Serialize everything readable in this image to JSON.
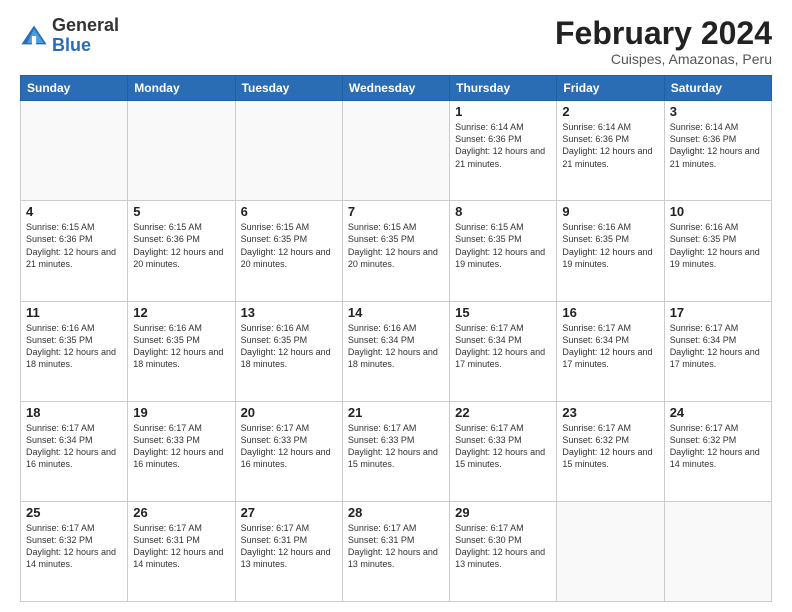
{
  "logo": {
    "general": "General",
    "blue": "Blue"
  },
  "header": {
    "title": "February 2024",
    "location": "Cuispes, Amazonas, Peru"
  },
  "weekdays": [
    "Sunday",
    "Monday",
    "Tuesday",
    "Wednesday",
    "Thursday",
    "Friday",
    "Saturday"
  ],
  "weeks": [
    [
      {
        "day": "",
        "info": ""
      },
      {
        "day": "",
        "info": ""
      },
      {
        "day": "",
        "info": ""
      },
      {
        "day": "",
        "info": ""
      },
      {
        "day": "1",
        "info": "Sunrise: 6:14 AM\nSunset: 6:36 PM\nDaylight: 12 hours and 21 minutes."
      },
      {
        "day": "2",
        "info": "Sunrise: 6:14 AM\nSunset: 6:36 PM\nDaylight: 12 hours and 21 minutes."
      },
      {
        "day": "3",
        "info": "Sunrise: 6:14 AM\nSunset: 6:36 PM\nDaylight: 12 hours and 21 minutes."
      }
    ],
    [
      {
        "day": "4",
        "info": "Sunrise: 6:15 AM\nSunset: 6:36 PM\nDaylight: 12 hours and 21 minutes."
      },
      {
        "day": "5",
        "info": "Sunrise: 6:15 AM\nSunset: 6:36 PM\nDaylight: 12 hours and 20 minutes."
      },
      {
        "day": "6",
        "info": "Sunrise: 6:15 AM\nSunset: 6:35 PM\nDaylight: 12 hours and 20 minutes."
      },
      {
        "day": "7",
        "info": "Sunrise: 6:15 AM\nSunset: 6:35 PM\nDaylight: 12 hours and 20 minutes."
      },
      {
        "day": "8",
        "info": "Sunrise: 6:15 AM\nSunset: 6:35 PM\nDaylight: 12 hours and 19 minutes."
      },
      {
        "day": "9",
        "info": "Sunrise: 6:16 AM\nSunset: 6:35 PM\nDaylight: 12 hours and 19 minutes."
      },
      {
        "day": "10",
        "info": "Sunrise: 6:16 AM\nSunset: 6:35 PM\nDaylight: 12 hours and 19 minutes."
      }
    ],
    [
      {
        "day": "11",
        "info": "Sunrise: 6:16 AM\nSunset: 6:35 PM\nDaylight: 12 hours and 18 minutes."
      },
      {
        "day": "12",
        "info": "Sunrise: 6:16 AM\nSunset: 6:35 PM\nDaylight: 12 hours and 18 minutes."
      },
      {
        "day": "13",
        "info": "Sunrise: 6:16 AM\nSunset: 6:35 PM\nDaylight: 12 hours and 18 minutes."
      },
      {
        "day": "14",
        "info": "Sunrise: 6:16 AM\nSunset: 6:34 PM\nDaylight: 12 hours and 18 minutes."
      },
      {
        "day": "15",
        "info": "Sunrise: 6:17 AM\nSunset: 6:34 PM\nDaylight: 12 hours and 17 minutes."
      },
      {
        "day": "16",
        "info": "Sunrise: 6:17 AM\nSunset: 6:34 PM\nDaylight: 12 hours and 17 minutes."
      },
      {
        "day": "17",
        "info": "Sunrise: 6:17 AM\nSunset: 6:34 PM\nDaylight: 12 hours and 17 minutes."
      }
    ],
    [
      {
        "day": "18",
        "info": "Sunrise: 6:17 AM\nSunset: 6:34 PM\nDaylight: 12 hours and 16 minutes."
      },
      {
        "day": "19",
        "info": "Sunrise: 6:17 AM\nSunset: 6:33 PM\nDaylight: 12 hours and 16 minutes."
      },
      {
        "day": "20",
        "info": "Sunrise: 6:17 AM\nSunset: 6:33 PM\nDaylight: 12 hours and 16 minutes."
      },
      {
        "day": "21",
        "info": "Sunrise: 6:17 AM\nSunset: 6:33 PM\nDaylight: 12 hours and 15 minutes."
      },
      {
        "day": "22",
        "info": "Sunrise: 6:17 AM\nSunset: 6:33 PM\nDaylight: 12 hours and 15 minutes."
      },
      {
        "day": "23",
        "info": "Sunrise: 6:17 AM\nSunset: 6:32 PM\nDaylight: 12 hours and 15 minutes."
      },
      {
        "day": "24",
        "info": "Sunrise: 6:17 AM\nSunset: 6:32 PM\nDaylight: 12 hours and 14 minutes."
      }
    ],
    [
      {
        "day": "25",
        "info": "Sunrise: 6:17 AM\nSunset: 6:32 PM\nDaylight: 12 hours and 14 minutes."
      },
      {
        "day": "26",
        "info": "Sunrise: 6:17 AM\nSunset: 6:31 PM\nDaylight: 12 hours and 14 minutes."
      },
      {
        "day": "27",
        "info": "Sunrise: 6:17 AM\nSunset: 6:31 PM\nDaylight: 12 hours and 13 minutes."
      },
      {
        "day": "28",
        "info": "Sunrise: 6:17 AM\nSunset: 6:31 PM\nDaylight: 12 hours and 13 minutes."
      },
      {
        "day": "29",
        "info": "Sunrise: 6:17 AM\nSunset: 6:30 PM\nDaylight: 12 hours and 13 minutes."
      },
      {
        "day": "",
        "info": ""
      },
      {
        "day": "",
        "info": ""
      }
    ]
  ]
}
